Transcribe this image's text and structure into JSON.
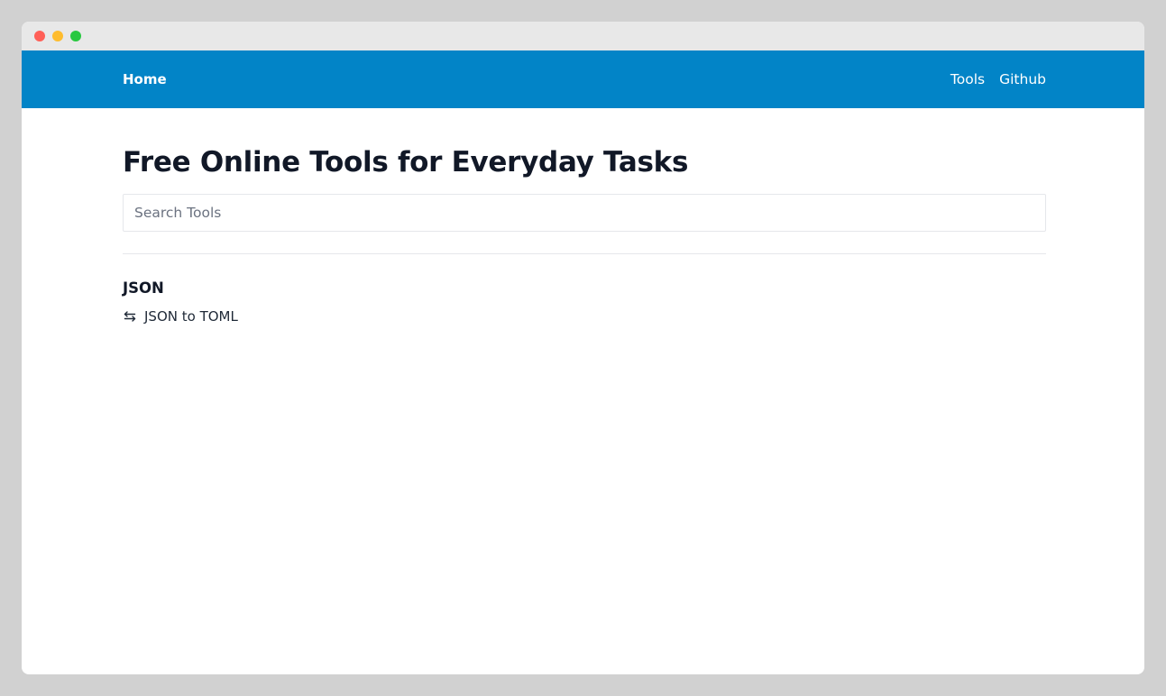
{
  "navbar": {
    "home_label": "Home",
    "links": [
      {
        "label": "Tools"
      },
      {
        "label": "Github"
      }
    ],
    "background_color": "#0284c7"
  },
  "main": {
    "title": "Free Online Tools for Everyday Tasks",
    "search": {
      "placeholder": "Search Tools",
      "value": ""
    },
    "categories": [
      {
        "heading": "JSON",
        "tools": [
          {
            "icon": "swap-arrows-icon",
            "label": "JSON to TOML"
          }
        ]
      }
    ]
  }
}
